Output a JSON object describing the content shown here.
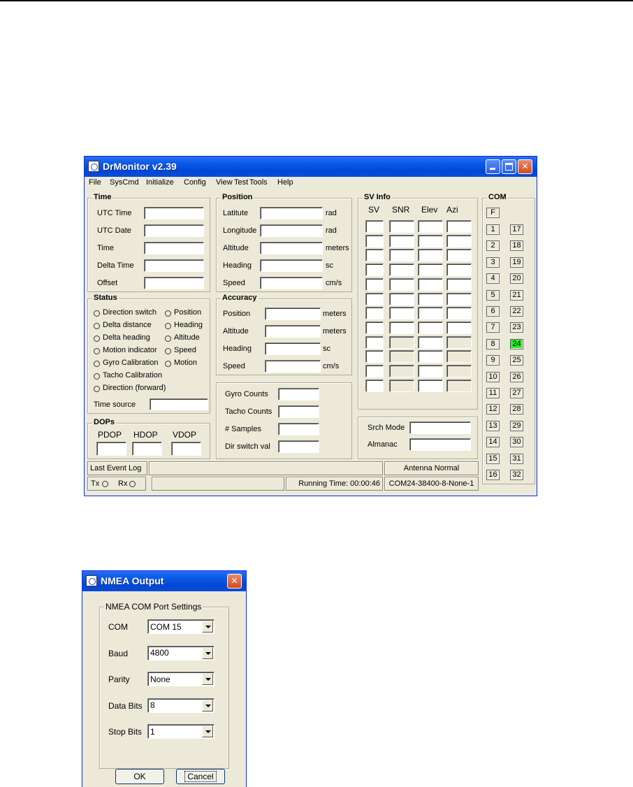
{
  "main_window": {
    "title": "DrMonitor v2.39",
    "menu": [
      "File",
      "SysCmd",
      "Initialize",
      "Config",
      "View",
      "Test",
      "Tools",
      "Help"
    ],
    "time": {
      "label": "Time",
      "fields": [
        "UTC Time",
        "UTC Date",
        "Time",
        "Delta Time",
        "Offset"
      ]
    },
    "position": {
      "label": "Position",
      "fields": [
        {
          "label": "Latitute",
          "unit": "rad"
        },
        {
          "label": "Longitude",
          "unit": "rad"
        },
        {
          "label": "Altitude",
          "unit": "meters"
        },
        {
          "label": "Heading",
          "unit": "sc"
        },
        {
          "label": "Speed",
          "unit": "cm/s"
        }
      ]
    },
    "sv_info": {
      "label": "SV Info",
      "columns": [
        "SV",
        "SNR",
        "Elev",
        "Azi"
      ],
      "rows": 12,
      "grey_from_row": 8
    },
    "com": {
      "label": "COM",
      "f_button": "F",
      "left": [
        "1",
        "2",
        "3",
        "4",
        "5",
        "6",
        "7",
        "8",
        "9",
        "10",
        "11",
        "12",
        "13",
        "14",
        "15",
        "16"
      ],
      "right": [
        "17",
        "18",
        "19",
        "20",
        "21",
        "22",
        "23",
        "24",
        "25",
        "26",
        "27",
        "28",
        "29",
        "30",
        "31",
        "32"
      ],
      "active": "24",
      "active_color": "#22ee22"
    },
    "status": {
      "label": "Status",
      "left": [
        "Direction switch",
        "Delta distance",
        "Delta heading",
        "Motion indicator",
        "Gyro Calibration",
        "Tacho Calibration",
        "Direction (forward)"
      ],
      "right": [
        "Position",
        "Heading",
        "Altitude",
        "Speed",
        "Motion"
      ],
      "time_source_label": "Time source"
    },
    "accuracy": {
      "label": "Accuracy",
      "fields": [
        {
          "label": "Position",
          "unit": "meters"
        },
        {
          "label": "Altitude",
          "unit": "meters"
        },
        {
          "label": "Heading",
          "unit": "sc"
        },
        {
          "label": "Speed",
          "unit": "cm/s"
        }
      ]
    },
    "counts": [
      "Gyro Counts",
      "Tacho Counts",
      "# Samples",
      "Dir switch val"
    ],
    "dops": {
      "label": "DOPs",
      "columns": [
        "PDOP",
        "HDOP",
        "VDOP"
      ]
    },
    "search": [
      "Srch Mode",
      "Almanac"
    ],
    "statusbar": {
      "last_event_log": "Last Event Log",
      "antenna": "Antenna Normal",
      "tx": "Tx",
      "rx": "Rx",
      "running_time": "Running Time: 00:00:46",
      "port_info": "COM24-38400-8-None-1"
    }
  },
  "nmea_window": {
    "title": "NMEA Output",
    "group_label": "NMEA COM Port Settings",
    "fields": [
      {
        "label": "COM",
        "value": "COM 15"
      },
      {
        "label": "Baud",
        "value": "4800"
      },
      {
        "label": "Parity",
        "value": "None"
      },
      {
        "label": "Data Bits",
        "value": "8"
      },
      {
        "label": "Stop Bits",
        "value": "1"
      }
    ],
    "ok_label": "OK",
    "cancel_label": "Cancel"
  }
}
